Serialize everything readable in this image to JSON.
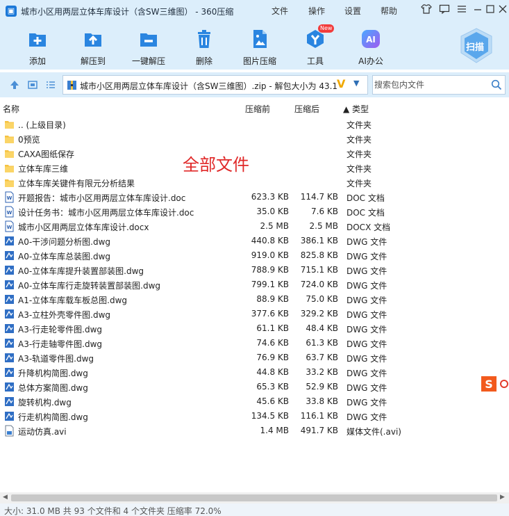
{
  "window": {
    "title": "城市小区用两层立体车库设计（含SW三维图） - 360压缩",
    "menu": [
      "文件",
      "操作",
      "设置",
      "帮助"
    ]
  },
  "toolbar": {
    "tools": [
      {
        "label": "添加",
        "icon": "add-icon"
      },
      {
        "label": "解压到",
        "icon": "extract-to-icon"
      },
      {
        "label": "一键解压",
        "icon": "one-click-extract-icon"
      },
      {
        "label": "删除",
        "icon": "trash-icon"
      },
      {
        "label": "图片压缩",
        "icon": "image-compress-icon"
      },
      {
        "label": "工具",
        "icon": "tools-icon",
        "badge": "New"
      },
      {
        "label": "AI办公",
        "icon": "ai-office-icon",
        "badge_text": "AI"
      }
    ],
    "scan_label": "扫描"
  },
  "address": {
    "path": "城市小区用两层立体车库设计（含SW三维图）.zip - 解包大小为 43.1",
    "search_placeholder": "搜索包内文件"
  },
  "columns": {
    "name": "名称",
    "size": "压缩前",
    "packed": "压缩后",
    "type": "▲ 类型"
  },
  "files": [
    {
      "name": ".. (上级目录)",
      "size": "",
      "packed": "",
      "type": "文件夹",
      "icon": "folder"
    },
    {
      "name": "0预览",
      "size": "",
      "packed": "",
      "type": "文件夹",
      "icon": "folder"
    },
    {
      "name": "CAXA图纸保存",
      "size": "",
      "packed": "",
      "type": "文件夹",
      "icon": "folder"
    },
    {
      "name": "立体车库三维",
      "size": "",
      "packed": "",
      "type": "文件夹",
      "icon": "folder"
    },
    {
      "name": "立体车库关键件有限元分析结果",
      "size": "",
      "packed": "",
      "type": "文件夹",
      "icon": "folder"
    },
    {
      "name": "开题报告：城市小区用两层立体车库设计.doc",
      "size": "623.3 KB",
      "packed": "114.7 KB",
      "type": "DOC 文档",
      "icon": "doc"
    },
    {
      "name": "设计任务书：城市小区用两层立体车库设计.doc",
      "size": "35.0 KB",
      "packed": "7.6 KB",
      "type": "DOC 文档",
      "icon": "doc"
    },
    {
      "name": "城市小区用两层立体车库设计.docx",
      "size": "2.5 MB",
      "packed": "2.5 MB",
      "type": "DOCX 文档",
      "icon": "doc"
    },
    {
      "name": "A0-干涉问题分析图.dwg",
      "size": "440.8 KB",
      "packed": "386.1 KB",
      "type": "DWG 文件",
      "icon": "dwg"
    },
    {
      "name": "A0-立体车库总装图.dwg",
      "size": "919.0 KB",
      "packed": "825.8 KB",
      "type": "DWG 文件",
      "icon": "dwg"
    },
    {
      "name": "A0-立体车库提升装置部装图.dwg",
      "size": "788.9 KB",
      "packed": "715.1 KB",
      "type": "DWG 文件",
      "icon": "dwg"
    },
    {
      "name": "A0-立体车库行走旋转装置部装图.dwg",
      "size": "799.1 KB",
      "packed": "724.0 KB",
      "type": "DWG 文件",
      "icon": "dwg"
    },
    {
      "name": "A1-立体车库载车板总图.dwg",
      "size": "88.9 KB",
      "packed": "75.0 KB",
      "type": "DWG 文件",
      "icon": "dwg"
    },
    {
      "name": "A3-立柱外壳零件图.dwg",
      "size": "377.6 KB",
      "packed": "329.2 KB",
      "type": "DWG 文件",
      "icon": "dwg"
    },
    {
      "name": "A3-行走轮零件图.dwg",
      "size": "61.1 KB",
      "packed": "48.4 KB",
      "type": "DWG 文件",
      "icon": "dwg"
    },
    {
      "name": "A3-行走轴零件图.dwg",
      "size": "74.6 KB",
      "packed": "61.3 KB",
      "type": "DWG 文件",
      "icon": "dwg"
    },
    {
      "name": "A3-轨道零件图.dwg",
      "size": "76.9 KB",
      "packed": "63.7 KB",
      "type": "DWG 文件",
      "icon": "dwg"
    },
    {
      "name": "升降机构简图.dwg",
      "size": "44.8 KB",
      "packed": "33.2 KB",
      "type": "DWG 文件",
      "icon": "dwg"
    },
    {
      "name": "总体方案简图.dwg",
      "size": "65.3 KB",
      "packed": "52.9 KB",
      "type": "DWG 文件",
      "icon": "dwg"
    },
    {
      "name": "旋转机构.dwg",
      "size": "45.6 KB",
      "packed": "33.8 KB",
      "type": "DWG 文件",
      "icon": "dwg"
    },
    {
      "name": "行走机构简图.dwg",
      "size": "134.5 KB",
      "packed": "116.1 KB",
      "type": "DWG 文件",
      "icon": "dwg"
    },
    {
      "name": "运动仿真.avi",
      "size": "1.4 MB",
      "packed": "491.7 KB",
      "type": "媒体文件(.avi)",
      "icon": "avi"
    }
  ],
  "annotation": "全部文件",
  "status": "大小: 31.0 MB 共 93 个文件和 4 个文件夹 压缩率 72.0%",
  "colors": {
    "chrome_bg": "#dceefb",
    "accent": "#1b78d8",
    "folder": "#f5c242",
    "annotation": "#e02828"
  }
}
